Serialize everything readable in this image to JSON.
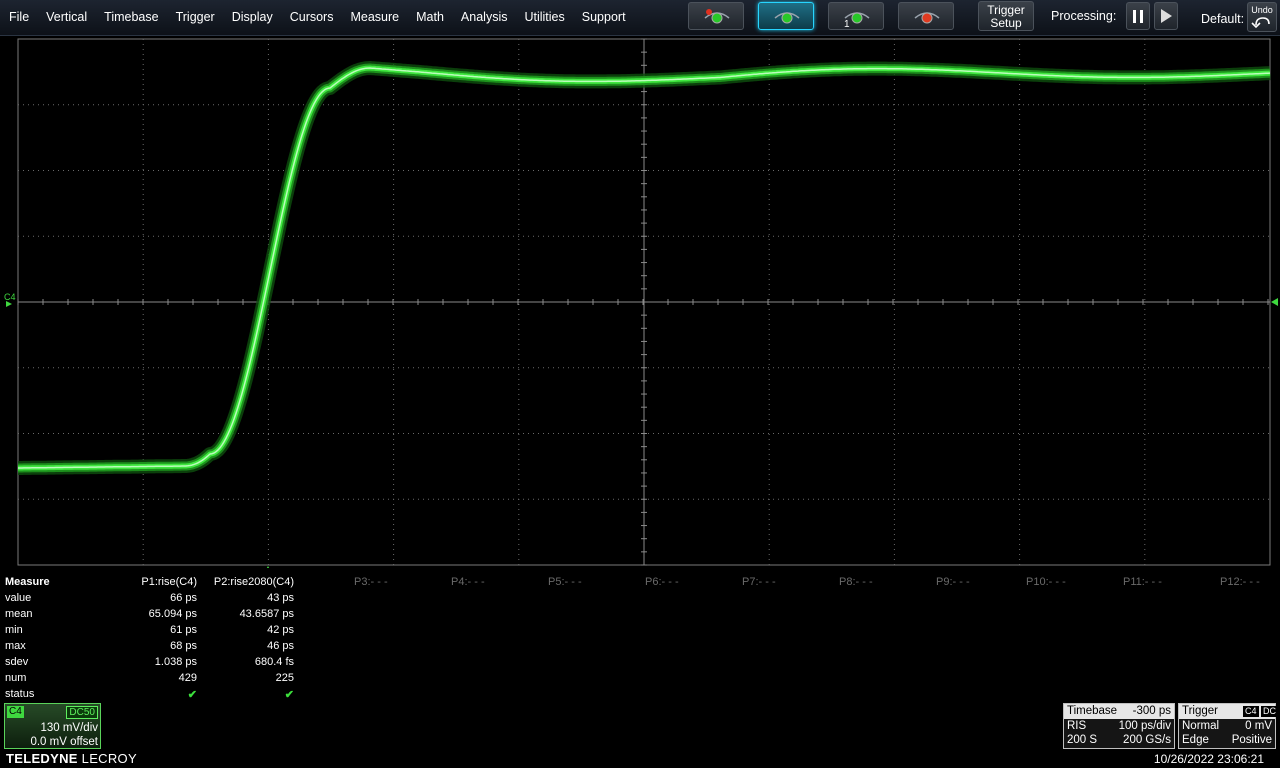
{
  "menu": [
    "File",
    "Vertical",
    "Timebase",
    "Trigger",
    "Display",
    "Cursors",
    "Measure",
    "Math",
    "Analysis",
    "Utilities",
    "Support"
  ],
  "toolbar": {
    "trigger_setup": [
      "Trigger",
      "Setup"
    ],
    "processing_label": "Processing:",
    "default_label": "Default:",
    "undo_label": "Undo"
  },
  "grid": {
    "channel_label": "C4"
  },
  "measure": {
    "title": "Measure",
    "headers": [
      "P1:rise(C4)",
      "P2:rise2080(C4)",
      "P3:- - -",
      "P4:- - -",
      "P5:- - -",
      "P6:- - -",
      "P7:- - -",
      "P8:- - -",
      "P9:- - -",
      "P10:- - -",
      "P11:- - -",
      "P12:- - -"
    ],
    "rows": [
      {
        "label": "value",
        "p1": "66 ps",
        "p2": "43 ps"
      },
      {
        "label": "mean",
        "p1": "65.094 ps",
        "p2": "43.6587 ps"
      },
      {
        "label": "min",
        "p1": "61 ps",
        "p2": "42 ps"
      },
      {
        "label": "max",
        "p1": "68 ps",
        "p2": "46 ps"
      },
      {
        "label": "sdev",
        "p1": "1.038 ps",
        "p2": "680.4 fs"
      },
      {
        "label": "num",
        "p1": "429",
        "p2": "225"
      },
      {
        "label": "status",
        "p1": "✔",
        "p2": "✔"
      }
    ]
  },
  "channel": {
    "name": "C4",
    "coupling": "DC50",
    "vdiv": "130 mV/div",
    "offset": "0.0 mV offset",
    "color": "#3fd83f"
  },
  "timebase": {
    "title": "Timebase",
    "delay": "-300 ps",
    "mode": "RIS",
    "tdiv": "100 ps/div",
    "samples": "200 S",
    "rate": "200 GS/s"
  },
  "trigger": {
    "title": "Trigger",
    "source": "C4",
    "coupling": "DC",
    "mode": "Normal",
    "level": "0 mV",
    "type": "Edge",
    "slope": "Positive"
  },
  "brand": {
    "bold": "TELEDYNE",
    "rest": " LECROY"
  },
  "datetime": "10/26/2022 23:06:21"
}
